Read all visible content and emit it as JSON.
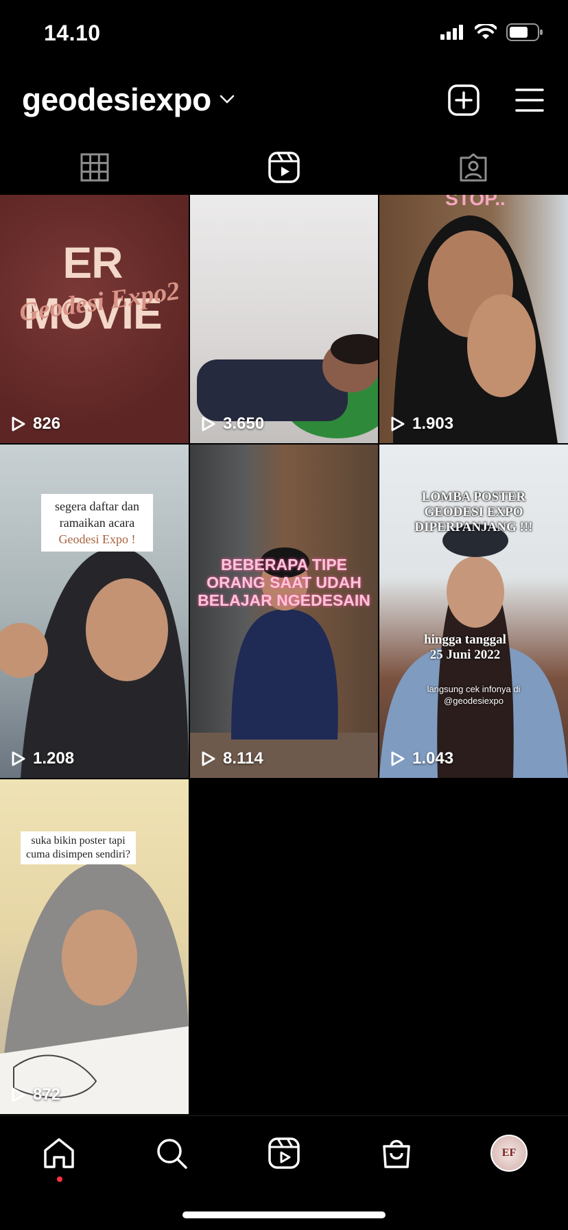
{
  "status_bar": {
    "time": "14.10"
  },
  "header": {
    "username": "geodesiexpo"
  },
  "tabs": [
    {
      "icon": "grid-icon"
    },
    {
      "icon": "reels-icon",
      "active": true
    },
    {
      "icon": "tagged-icon"
    }
  ],
  "reels": [
    {
      "plays": "826",
      "caption": "ER MOVIE",
      "subcaption": "Geodesi Expo2"
    },
    {
      "plays": "3.650"
    },
    {
      "plays": "1.903",
      "caption": "STOP.."
    },
    {
      "plays": "1.208",
      "caption_lines": [
        "segera daftar dan",
        "ramaikan acara",
        "Geodesi Expo !"
      ]
    },
    {
      "plays": "8.114",
      "caption_lines": [
        "BEBERAPA TIPE",
        "ORANG SAAT UDAH",
        "BELAJAR NGEDESAIN"
      ]
    },
    {
      "plays": "1.043",
      "caption_lines": [
        "LOMBA POSTER",
        "GEODESI  EXPO",
        "DIPERPANJANG !!!"
      ],
      "date_lines": [
        "hingga tanggal",
        "25 Juni 2022"
      ],
      "info_lines": [
        "langsung cek infonya di",
        "@geodesiexpo"
      ]
    },
    {
      "plays": "872",
      "caption_lines": [
        "suka bikin poster tapi",
        "cuma disimpen sendiri?"
      ]
    }
  ],
  "profile_badge": "EF",
  "accent": {
    "notification_dot": "#ff3040"
  }
}
